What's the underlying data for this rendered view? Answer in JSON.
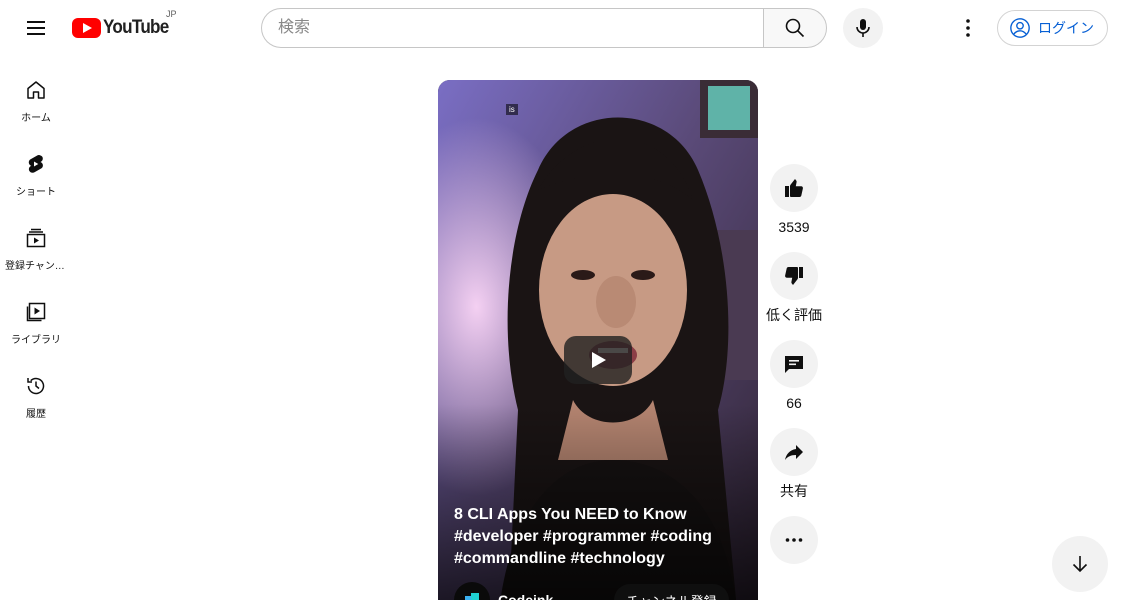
{
  "header": {
    "logo_text": "YouTube",
    "region": "JP",
    "search_placeholder": "検索",
    "search_value": "",
    "login_label": "ログイン"
  },
  "sidebar": {
    "items": [
      {
        "label": "ホーム",
        "icon": "home-icon"
      },
      {
        "label": "ショート",
        "icon": "shorts-icon"
      },
      {
        "label": "登録チャンネル",
        "icon": "subscriptions-icon"
      },
      {
        "label": "ライブラリ",
        "icon": "library-icon"
      },
      {
        "label": "履歴",
        "icon": "history-icon"
      }
    ]
  },
  "short": {
    "badge": "is",
    "title": "8 CLI Apps You NEED to Know #developer #programmer #coding #commandline #technology",
    "channel_name": "Codeink",
    "subscribe_label": "チャンネル登録"
  },
  "actions": {
    "like_count": "3539",
    "dislike_label": "低く評価",
    "comment_count": "66",
    "share_label": "共有"
  },
  "colors": {
    "brand_red": "#ff0000",
    "link_blue": "#065fd4",
    "button_bg": "#f2f2f2"
  }
}
